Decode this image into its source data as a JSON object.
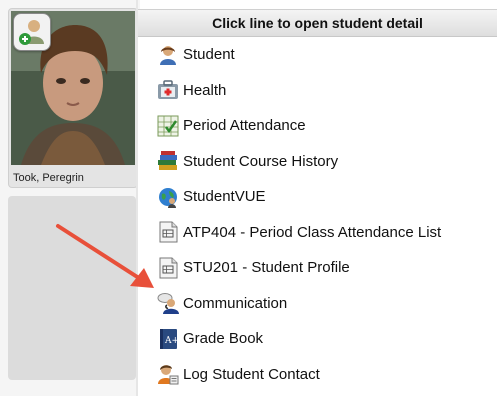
{
  "student": {
    "name": "Took, Peregrin"
  },
  "menu": {
    "header": "Click line to open student detail",
    "items": [
      {
        "label": "Student",
        "icon": "student-icon"
      },
      {
        "label": "Health",
        "icon": "health-kit-icon"
      },
      {
        "label": "Period Attendance",
        "icon": "period-attendance-icon"
      },
      {
        "label": "Student Course History",
        "icon": "course-history-books-icon"
      },
      {
        "label": "StudentVUE",
        "icon": "globe-user-icon"
      },
      {
        "label": "ATP404 - Period Class Attendance List",
        "icon": "report-document-icon"
      },
      {
        "label": "STU201 - Student Profile",
        "icon": "report-document-icon"
      },
      {
        "label": "Communication",
        "icon": "communication-icon"
      },
      {
        "label": "Grade Book",
        "icon": "grade-book-icon"
      },
      {
        "label": "Log Student Contact",
        "icon": "log-contact-icon"
      }
    ]
  },
  "colors": {
    "arrow": "#e8503a",
    "header_bg": "#e6e6e6",
    "panel_bg": "#dcdcdc"
  }
}
